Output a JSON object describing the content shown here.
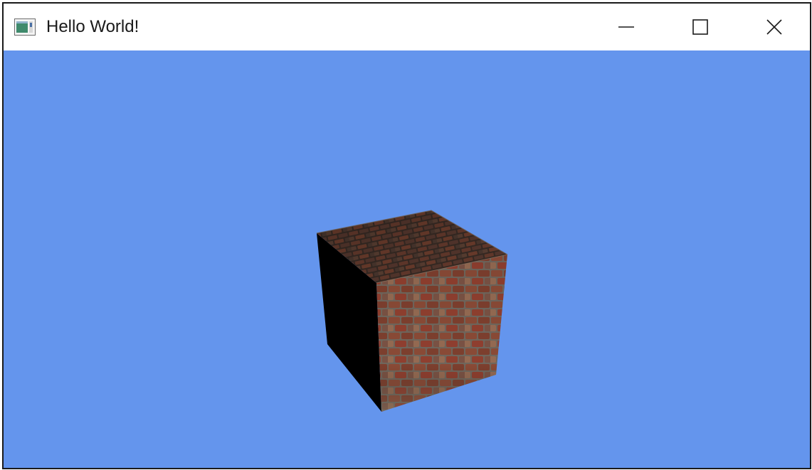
{
  "window": {
    "title": "Hello World!",
    "controls": {
      "minimize_icon": "minimize-icon",
      "maximize_icon": "maximize-icon",
      "close_icon": "close-icon"
    }
  },
  "viewport": {
    "clear_color": "#6495ed",
    "object": "textured-brick-cube"
  },
  "colors": {
    "titlebar_bg": "#ffffff",
    "border": "#1a1a1a",
    "brick_mortar": "#7b7369",
    "brick_red": "#8c4a36",
    "shadow_face": "#000000"
  }
}
